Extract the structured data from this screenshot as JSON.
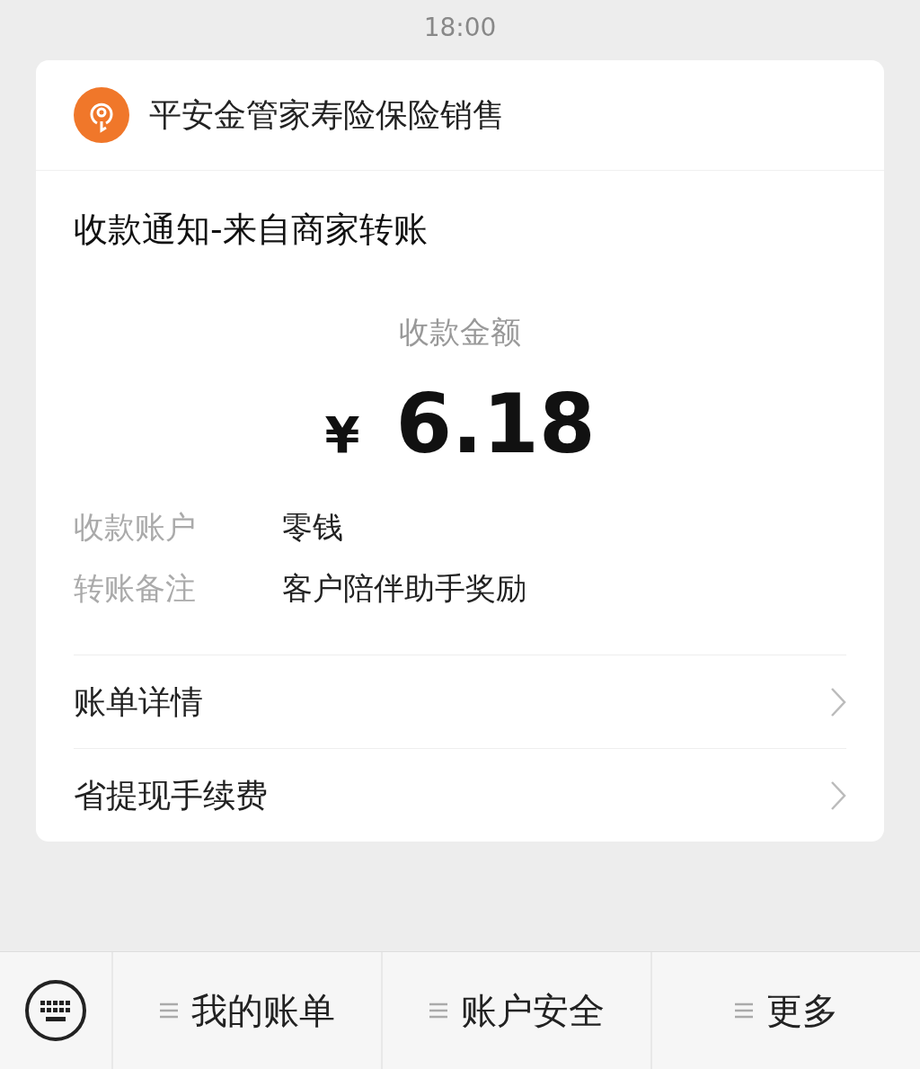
{
  "status_bar": {
    "time": "18:00"
  },
  "message": {
    "sender": "平安金管家寿险保险销售",
    "title": "收款通知-来自商家转账",
    "amount_label": "收款金额",
    "currency": "¥",
    "amount": "6.18",
    "fields": [
      {
        "label": "收款账户",
        "value": "零钱"
      },
      {
        "label": "转账备注",
        "value": "客户陪伴助手奖励"
      }
    ],
    "links": [
      {
        "label": "账单详情"
      },
      {
        "label": "省提现手续费"
      }
    ]
  },
  "menu_bar": {
    "items": [
      {
        "label": "我的账单"
      },
      {
        "label": "账户安全"
      },
      {
        "label": "更多"
      }
    ]
  }
}
